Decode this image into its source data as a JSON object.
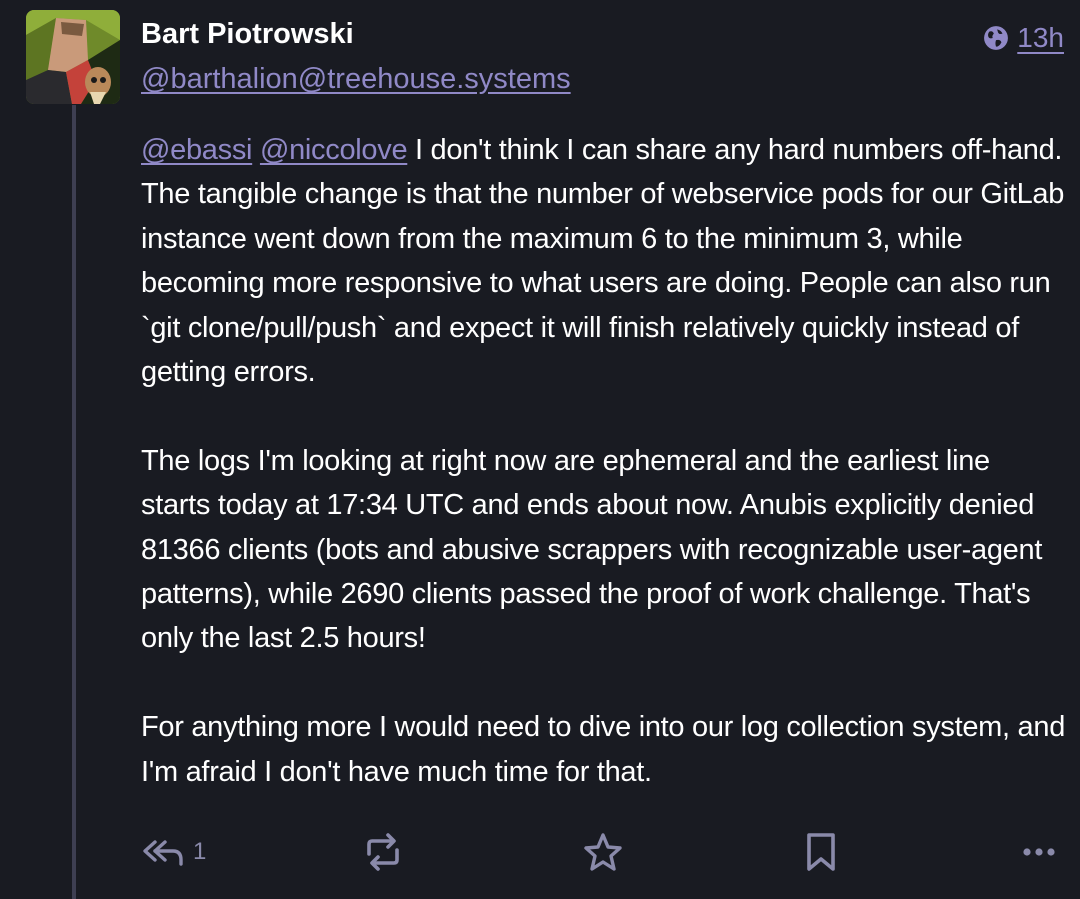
{
  "author": {
    "display_name": "Bart Piotrowski",
    "handle": "@barthalion@treehouse.systems"
  },
  "meta": {
    "visibility_icon": "globe-icon",
    "timestamp": "13h"
  },
  "content": {
    "mentions": [
      "@ebassi",
      "@niccolove"
    ],
    "paragraph1_text": "I don't think I can share any hard numbers off-hand. The tangible change is that the number of webservice pods for our GitLab instance went down from the maximum 6 to the minimum 3, while becoming more responsive to what users are doing. People can also run `git clone/pull/push` and expect it will finish relatively quickly instead of getting errors.",
    "paragraph2": "The logs I'm looking at right now are ephemeral and the earliest line starts today at 17:34 UTC and ends about now. Anubis explicitly denied 81366 clients (bots and abusive scrappers with recognizable user-agent patterns), while 2690 clients passed the proof of work challenge. That's only the last 2.5 hours!",
    "paragraph3": "For anything more I would need to dive into our log collection system, and I'm afraid I don't have much time for that."
  },
  "actions": {
    "reply": {
      "icon": "reply-all-icon",
      "count": "1"
    },
    "boost": {
      "icon": "boost-icon"
    },
    "favourite": {
      "icon": "star-icon"
    },
    "bookmark": {
      "icon": "bookmark-icon"
    },
    "more": {
      "icon": "more-icon"
    }
  },
  "colors": {
    "background": "#191b22",
    "accent": "#9089c7",
    "text": "#ffffff",
    "icon": "#8a8aaa",
    "thread_line": "#3e3f52"
  }
}
